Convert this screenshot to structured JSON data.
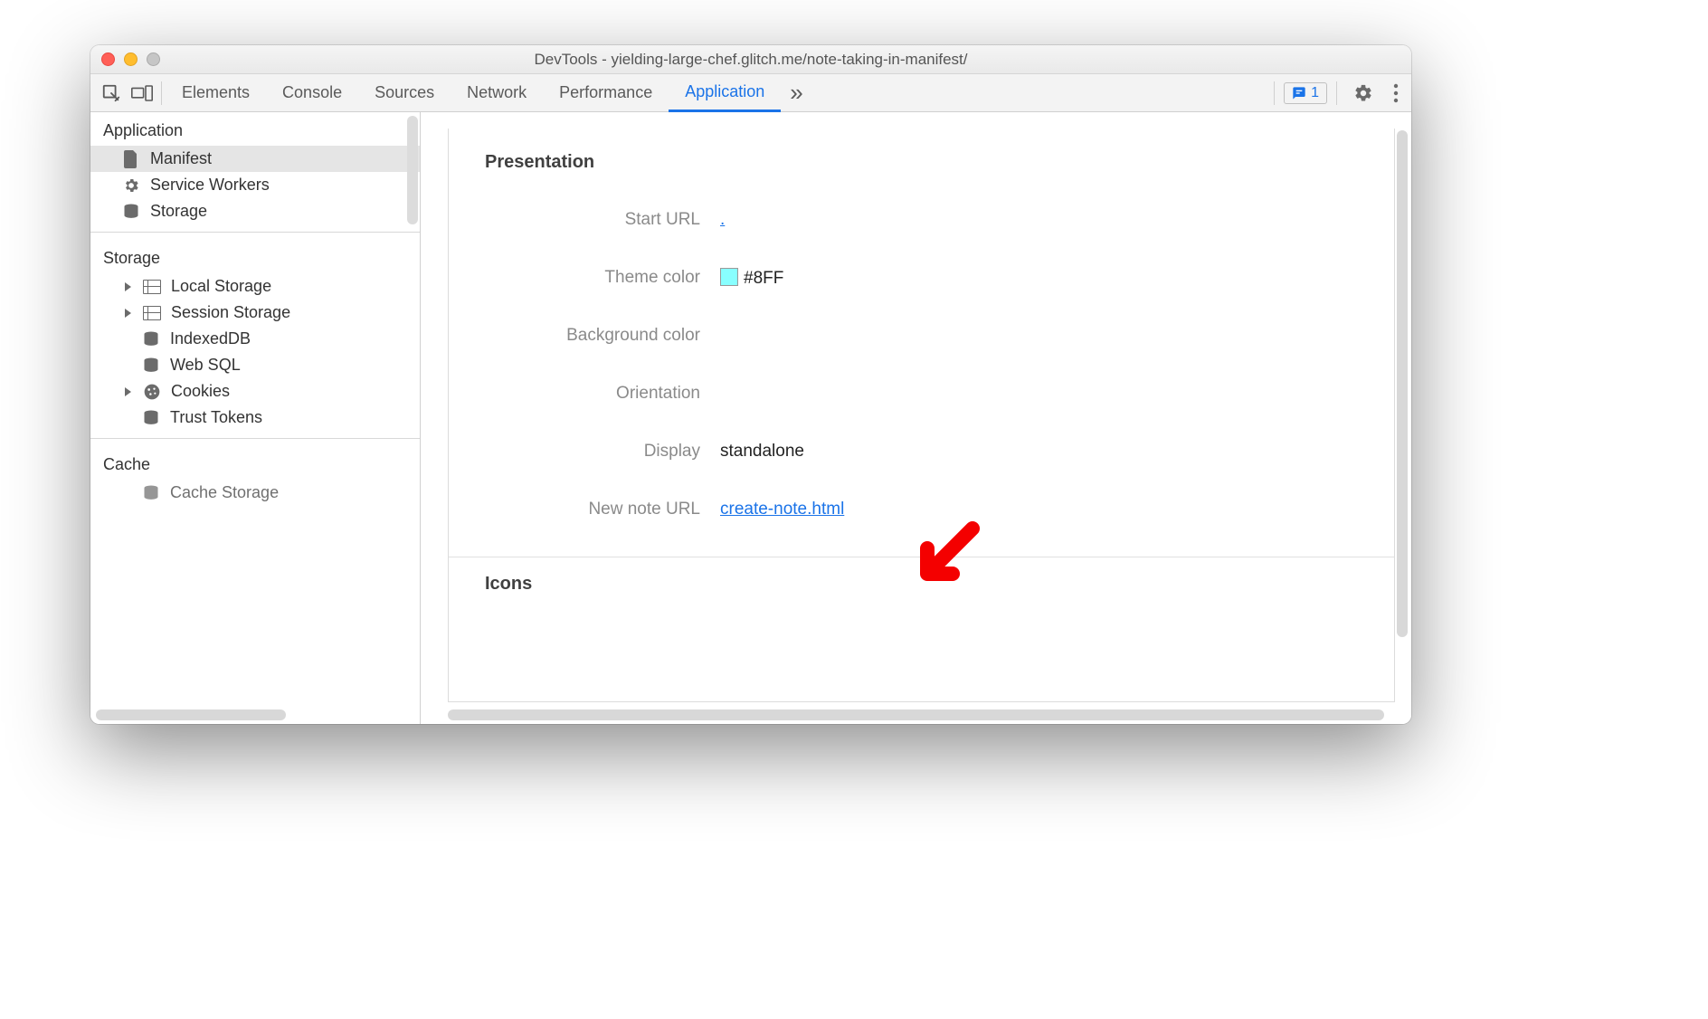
{
  "window_title": "DevTools - yielding-large-chef.glitch.me/note-taking-in-manifest/",
  "toolbar": {
    "tabs": {
      "elements": "Elements",
      "console": "Console",
      "sources": "Sources",
      "network": "Network",
      "performance": "Performance",
      "application": "Application"
    },
    "issue_count": "1"
  },
  "sidebar": {
    "sections": {
      "application": {
        "title": "Application",
        "manifest": "Manifest",
        "service_workers": "Service Workers",
        "storage_item": "Storage"
      },
      "storage": {
        "title": "Storage",
        "local_storage": "Local Storage",
        "session_storage": "Session Storage",
        "indexeddb": "IndexedDB",
        "web_sql": "Web SQL",
        "cookies": "Cookies",
        "trust_tokens": "Trust Tokens"
      },
      "cache": {
        "title": "Cache",
        "cache_storage": "Cache Storage"
      }
    }
  },
  "main": {
    "presentation_heading": "Presentation",
    "icons_heading": "Icons",
    "rows": {
      "start_url_label": "Start URL",
      "start_url_value": ".",
      "theme_color_label": "Theme color",
      "theme_color_value": "#8FF",
      "bg_color_label": "Background color",
      "orientation_label": "Orientation",
      "display_label": "Display",
      "display_value": "standalone",
      "new_note_url_label": "New note URL",
      "new_note_url_value": "create-note.html"
    }
  },
  "colors": {
    "theme_swatch": "#88ffff"
  }
}
